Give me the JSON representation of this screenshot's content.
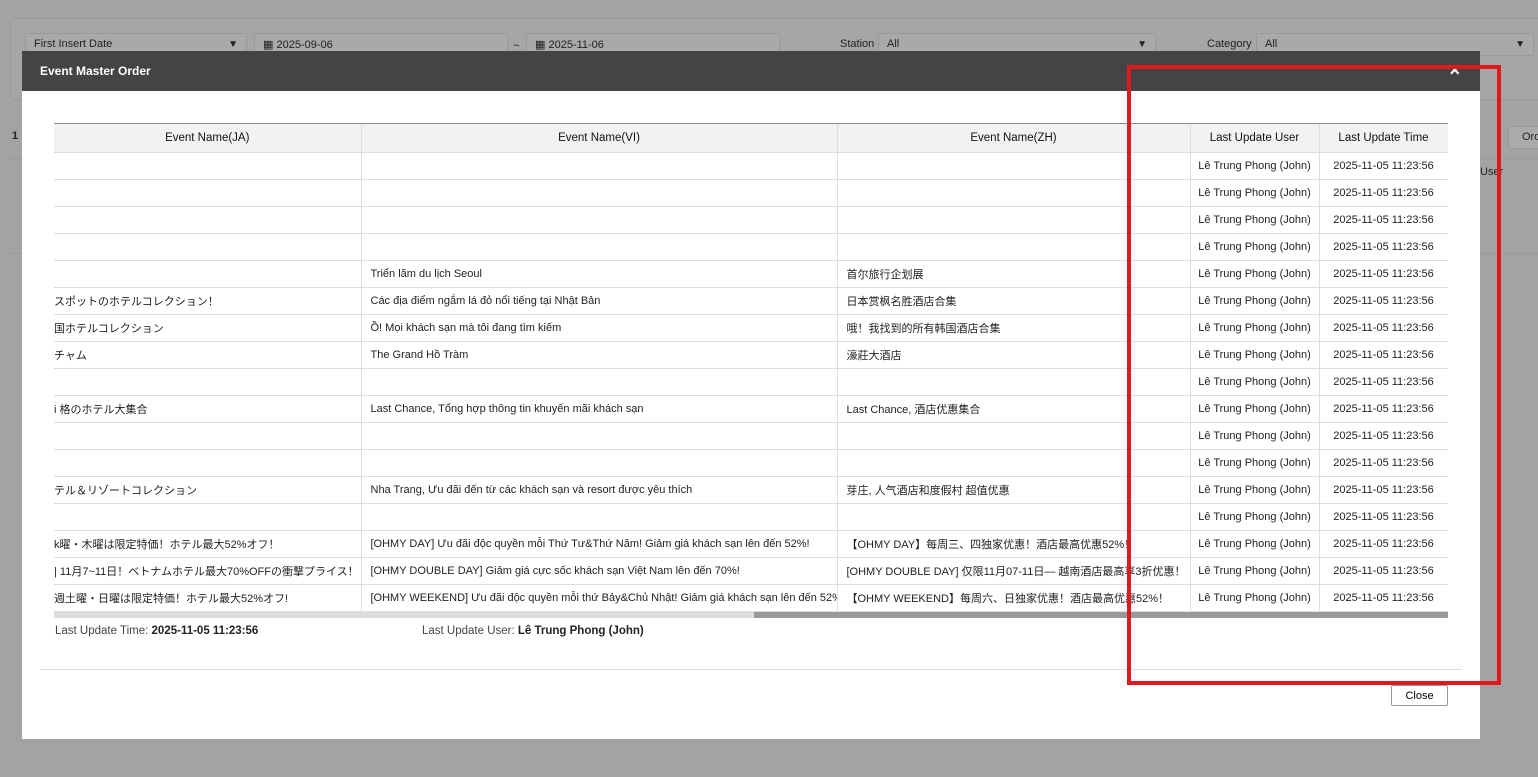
{
  "background": {
    "date_type": "First Insert Date",
    "date_from": "2025-09-06",
    "date_sep": "~",
    "date_to": "2025-11-06",
    "station_label": "Station",
    "station_value": "All",
    "category_label": "Category",
    "category_value": "All",
    "count": "1",
    "order_button": "Ord",
    "col_user": "User"
  },
  "modal": {
    "title": "Event Master Order",
    "columns": [
      "Event Name(JA)",
      "Event Name(VI)",
      "Event Name(ZH)",
      "Last Update User",
      "Last Update Time"
    ],
    "rows": [
      {
        "ja": "",
        "vi": "",
        "zh": "",
        "user": "Lê Trung Phong (John)",
        "time": "2025-11-05 11:23:56"
      },
      {
        "ja": "",
        "vi": "",
        "zh": "",
        "user": "Lê Trung Phong (John)",
        "time": "2025-11-05 11:23:56"
      },
      {
        "ja": "",
        "vi": "",
        "zh": "",
        "user": "Lê Trung Phong (John)",
        "time": "2025-11-05 11:23:56"
      },
      {
        "ja": "",
        "vi": "",
        "zh": "",
        "user": "Lê Trung Phong (John)",
        "time": "2025-11-05 11:23:56"
      },
      {
        "ja": "",
        "vi": "Triển lãm du lịch Seoul",
        "zh": "首尔旅行企划展",
        "user": "Lê Trung Phong (John)",
        "time": "2025-11-05 11:23:56"
      },
      {
        "ja": "スポットのホテルコレクション！",
        "vi": "Các địa điểm ngắm lá đỏ nổi tiếng tại Nhật Bản",
        "zh": "日本赏枫名胜酒店合集",
        "user": "Lê Trung Phong (John)",
        "time": "2025-11-05 11:23:56"
      },
      {
        "ja": "国ホテルコレクション",
        "vi": "Ồ! Mọi khách sạn mà tôi đang tìm kiếm",
        "zh": "哦！我找到的所有韩国酒店合集",
        "user": "Lê Trung Phong (John)",
        "time": "2025-11-05 11:23:56"
      },
      {
        "ja": "チャム",
        "vi": "The Grand Hồ Tràm",
        "zh": "濠莊大酒店",
        "user": "Lê Trung Phong (John)",
        "time": "2025-11-05 11:23:56"
      },
      {
        "ja": "",
        "vi": "",
        "zh": "",
        "user": "Lê Trung Phong (John)",
        "time": "2025-11-05 11:23:56"
      },
      {
        "ja": "i 格のホテル大集合",
        "vi": "Last Chance, Tổng hợp thông tin khuyến mãi khách sạn",
        "zh": "Last Chance, 酒店优惠集合",
        "user": "Lê Trung Phong (John)",
        "time": "2025-11-05 11:23:56"
      },
      {
        "ja": "",
        "vi": "",
        "zh": "",
        "user": "Lê Trung Phong (John)",
        "time": "2025-11-05 11:23:56"
      },
      {
        "ja": "",
        "vi": "",
        "zh": "",
        "user": "Lê Trung Phong (John)",
        "time": "2025-11-05 11:23:56"
      },
      {
        "ja": "テル＆リゾートコレクション",
        "vi": "Nha Trang, Ưu đãi đến từ các khách sạn và resort được yêu thích",
        "zh": "芽庄, 人气酒店和度假村 超值优惠",
        "user": "Lê Trung Phong (John)",
        "time": "2025-11-05 11:23:56"
      },
      {
        "ja": "",
        "vi": "",
        "zh": "",
        "user": "Lê Trung Phong (John)",
        "time": "2025-11-05 11:23:56"
      },
      {
        "ja": "k曜・木曜は限定特価！ホテル最大52%オフ！",
        "vi": "[OHMY DAY] Ưu đãi độc quyền mỗi Thứ Tư&Thứ Năm! Giảm giá khách sạn lên đến 52%!",
        "zh": "【OHMY DAY】每周三、四独家优惠！酒店最高优惠52%！",
        "user": "Lê Trung Phong (John)",
        "time": "2025-11-05 11:23:56"
      },
      {
        "ja": "| 11月7~11日！ベトナムホテル最大70%OFFの衝撃プライス！",
        "vi": "[OHMY DOUBLE DAY] Giảm giá cực sốc khách sạn Việt Nam lên đến 70%!",
        "zh": "[OHMY DOUBLE DAY] 仅限11月07-11日— 越南酒店最高享3折优惠！",
        "user": "Lê Trung Phong (John)",
        "time": "2025-11-05 11:23:56"
      },
      {
        "ja": "週土曜・日曜は限定特価！ホテル最大52%オフ!",
        "vi": "[OHMY WEEKEND] Ưu đãi độc quyền mỗi thứ Bảy&Chủ Nhật! Giảm giá khách sạn lên đến 52%!",
        "zh": "【OHMY WEEKEND】每周六、日独家优惠！酒店最高优惠52%！",
        "user": "Lê Trung Phong (John)",
        "time": "2025-11-05 11:23:56"
      }
    ],
    "footer": {
      "time_label": "Last Update Time:",
      "time_value": "2025-11-05 11:23:56",
      "user_label": "Last Update User:",
      "user_value": "Lê Trung Phong (John)"
    },
    "close_label": "Close",
    "close_icon": "×"
  },
  "colors": {
    "header": "#444444",
    "highlight": "#e0191e"
  }
}
